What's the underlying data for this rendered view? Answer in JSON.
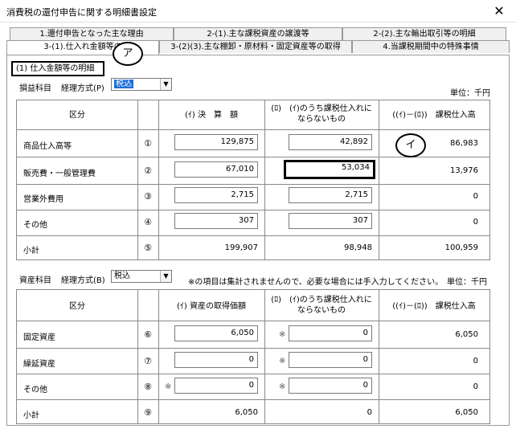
{
  "window": {
    "title": "消費税の還付申告に関する明細書設定",
    "close_glyph": "✕"
  },
  "tabs": {
    "row1": [
      "1.還付申告となった主な理由",
      "2-(1).主な課税資産の譲渡等",
      "2-(2).主な輸出取引等の明細"
    ],
    "row2": [
      "3-(1).仕入れ金額等の",
      "3-(2)(3).主な棚卸・原材料・固定資産等の取得",
      "4.当課税期間中の特殊事情"
    ]
  },
  "section1": {
    "title": "(1) 仕入金額等の明細",
    "account_label": "損益科目",
    "method_label": "経理方式(P)",
    "method_value": "税込",
    "unit": "単位：千円",
    "header": {
      "kubun": "区分",
      "col_a": "(ｲ) 決　算　額",
      "col_b": "(ﾛ)　(ｲ)のうち課税仕入れに\nならないもの",
      "col_c": "((ｲ)－(ﾛ))　課税仕入高"
    },
    "rows": [
      {
        "label": "商品仕入高等",
        "no": "①",
        "a": "129,875",
        "b": "42,892",
        "c": "86,983"
      },
      {
        "label": "販売費・一般管理費",
        "no": "②",
        "a": "67,010",
        "b": "53,034",
        "c": "13,976"
      },
      {
        "label": "営業外費用",
        "no": "③",
        "a": "2,715",
        "b": "2,715",
        "c": "0"
      },
      {
        "label": "その他",
        "no": "④",
        "a": "307",
        "b": "307",
        "c": "0"
      }
    ],
    "subtotal": {
      "label": "小計",
      "no": "⑤",
      "a": "199,907",
      "b": "98,948",
      "c": "100,959"
    }
  },
  "section2": {
    "account_label": "資産科目",
    "method_label": "経理方式(B)",
    "method_value": "税込",
    "note": "※の項目は集計されませんので、必要な場合には手入力してください。",
    "unit": "単位：千円",
    "header": {
      "kubun": "区分",
      "col_a": "(ｲ) 資産の取得価額",
      "col_b": "(ﾛ)　(ｲ)のうち課税仕入れに\nならないもの",
      "col_c": "((ｲ)－(ﾛ))　課税仕入高"
    },
    "rows": [
      {
        "label": "固定資産",
        "no": "⑥",
        "a": "6,050",
        "b": "0",
        "c": "6,050"
      },
      {
        "label": "繰延資産",
        "no": "⑦",
        "a": "0",
        "b": "0",
        "c": "0"
      },
      {
        "label": "その他",
        "no": "⑧",
        "a": "0",
        "b": "0",
        "c": "0"
      }
    ],
    "subtotal": {
      "label": "小計",
      "no": "⑨",
      "a": "6,050",
      "b": "0",
      "c": "6,050"
    },
    "kome": "※"
  },
  "callouts": {
    "a": "ア",
    "b": "イ"
  }
}
